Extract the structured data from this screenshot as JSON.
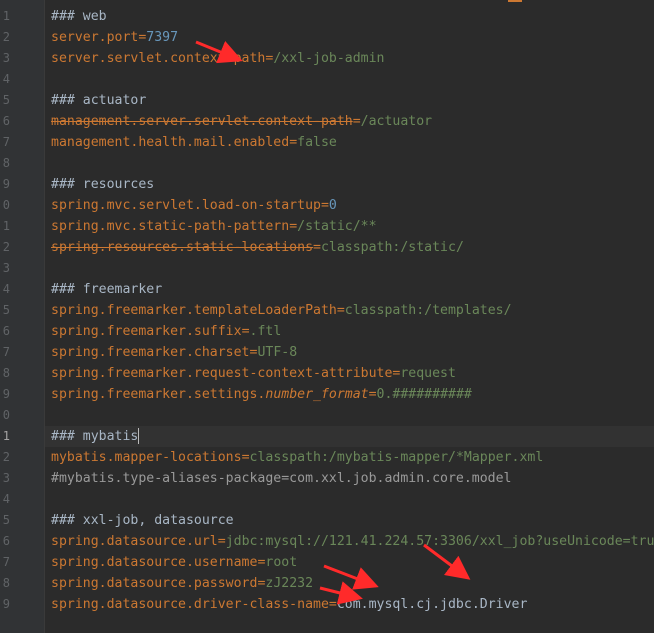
{
  "editor": {
    "lines": [
      {
        "num": "1",
        "tokens": [
          {
            "cls": "t-comment",
            "text": "### web"
          }
        ]
      },
      {
        "num": "2",
        "tokens": [
          {
            "cls": "t-key",
            "text": "server.port"
          },
          {
            "cls": "t-eq",
            "text": "="
          },
          {
            "cls": "t-number",
            "text": "7397"
          }
        ]
      },
      {
        "num": "3",
        "tokens": [
          {
            "cls": "t-key",
            "text": "server.servlet.context-path"
          },
          {
            "cls": "t-eq",
            "text": "="
          },
          {
            "cls": "t-value",
            "text": "/xxl-job-admin"
          }
        ]
      },
      {
        "num": "4",
        "tokens": []
      },
      {
        "num": "5",
        "tokens": [
          {
            "cls": "t-comment",
            "text": "### actuator"
          }
        ]
      },
      {
        "num": "6",
        "tokens": [
          {
            "cls": "t-key t-dep",
            "text": "management.server.servlet.context-path"
          },
          {
            "cls": "t-eq",
            "text": "="
          },
          {
            "cls": "t-value",
            "text": "/actuator"
          }
        ]
      },
      {
        "num": "7",
        "tokens": [
          {
            "cls": "t-key",
            "text": "management.health.mail.enabled"
          },
          {
            "cls": "t-eq",
            "text": "="
          },
          {
            "cls": "t-value",
            "text": "false"
          }
        ]
      },
      {
        "num": "8",
        "tokens": []
      },
      {
        "num": "9",
        "tokens": [
          {
            "cls": "t-comment",
            "text": "### resources"
          }
        ]
      },
      {
        "num": "0",
        "tokens": [
          {
            "cls": "t-key",
            "text": "spring.mvc.servlet.load-on-startup"
          },
          {
            "cls": "t-eq",
            "text": "="
          },
          {
            "cls": "t-number",
            "text": "0"
          }
        ]
      },
      {
        "num": "1",
        "tokens": [
          {
            "cls": "t-key",
            "text": "spring.mvc.static-path-pattern"
          },
          {
            "cls": "t-eq",
            "text": "="
          },
          {
            "cls": "t-value",
            "text": "/static/**"
          }
        ]
      },
      {
        "num": "2",
        "tokens": [
          {
            "cls": "t-key t-dep",
            "text": "spring.resources.static-locations"
          },
          {
            "cls": "t-eq",
            "text": "="
          },
          {
            "cls": "t-value",
            "text": "classpath:/static/"
          }
        ]
      },
      {
        "num": "3",
        "tokens": []
      },
      {
        "num": "4",
        "tokens": [
          {
            "cls": "t-comment",
            "text": "### freemarker"
          }
        ]
      },
      {
        "num": "5",
        "tokens": [
          {
            "cls": "t-key",
            "text": "spring.freemarker.templateLoaderPath"
          },
          {
            "cls": "t-eq",
            "text": "="
          },
          {
            "cls": "t-value",
            "text": "classpath:/templates/"
          }
        ]
      },
      {
        "num": "6",
        "tokens": [
          {
            "cls": "t-key",
            "text": "spring.freemarker.suffix"
          },
          {
            "cls": "t-eq",
            "text": "="
          },
          {
            "cls": "t-value",
            "text": ".ftl"
          }
        ]
      },
      {
        "num": "7",
        "tokens": [
          {
            "cls": "t-key",
            "text": "spring.freemarker.charset"
          },
          {
            "cls": "t-eq",
            "text": "="
          },
          {
            "cls": "t-value",
            "text": "UTF-8"
          }
        ]
      },
      {
        "num": "8",
        "tokens": [
          {
            "cls": "t-key",
            "text": "spring.freemarker.request-context-attribute"
          },
          {
            "cls": "t-eq",
            "text": "="
          },
          {
            "cls": "t-value",
            "text": "request"
          }
        ]
      },
      {
        "num": "9",
        "tokens": [
          {
            "cls": "t-key",
            "text": "spring.freemarker.settings."
          },
          {
            "cls": "t-key t-italic",
            "text": "number_format"
          },
          {
            "cls": "t-eq",
            "text": "="
          },
          {
            "cls": "t-value",
            "text": "0.##########"
          }
        ]
      },
      {
        "num": "0",
        "tokens": []
      },
      {
        "num": "1",
        "active": true,
        "tokens": [
          {
            "cls": "t-comment",
            "text": "### mybatis"
          },
          {
            "cls": "caret",
            "text": ""
          }
        ]
      },
      {
        "num": "2",
        "tokens": [
          {
            "cls": "t-key",
            "text": "mybatis.mapper-locations"
          },
          {
            "cls": "t-eq",
            "text": "="
          },
          {
            "cls": "t-value",
            "text": "classpath:/mybatis-mapper/*Mapper.xml"
          }
        ]
      },
      {
        "num": "3",
        "tokens": [
          {
            "cls": "t-comment gray",
            "text": "#mybatis.type-aliases-package=com.xxl.job.admin.core.model"
          }
        ]
      },
      {
        "num": "4",
        "tokens": []
      },
      {
        "num": "5",
        "tokens": [
          {
            "cls": "t-comment",
            "text": "### xxl-job, datasource"
          }
        ]
      },
      {
        "num": "6",
        "tokens": [
          {
            "cls": "t-key",
            "text": "spring.datasource.url"
          },
          {
            "cls": "t-eq",
            "text": "="
          },
          {
            "cls": "t-value",
            "text": "jdbc:mysql://121.41.224.57:3306/xxl_job?useUnicode=tru"
          }
        ]
      },
      {
        "num": "7",
        "tokens": [
          {
            "cls": "t-key",
            "text": "spring.datasource.username"
          },
          {
            "cls": "t-eq",
            "text": "="
          },
          {
            "cls": "t-value",
            "text": "root"
          }
        ]
      },
      {
        "num": "8",
        "tokens": [
          {
            "cls": "t-key",
            "text": "spring.datasource.password"
          },
          {
            "cls": "t-eq",
            "text": "="
          },
          {
            "cls": "t-value",
            "text": "zJ2232"
          }
        ]
      },
      {
        "num": "9",
        "tokens": [
          {
            "cls": "t-key",
            "text": "spring.datasource.driver-class-name"
          },
          {
            "cls": "t-eq",
            "text": "="
          },
          {
            "cls": "t-comment",
            "text": "com.mysql.cj.jdbc.Driver"
          }
        ]
      }
    ]
  },
  "colors": {
    "background": "#2b2b2b",
    "gutter": "#313335",
    "key": "#cc7832",
    "value": "#6a8759",
    "number": "#6897bb",
    "comment": "#a9b7c6",
    "annotation_arrow": "#ff2a2a"
  },
  "annotations": {
    "arrow_icon": "red-arrow-annotation"
  }
}
